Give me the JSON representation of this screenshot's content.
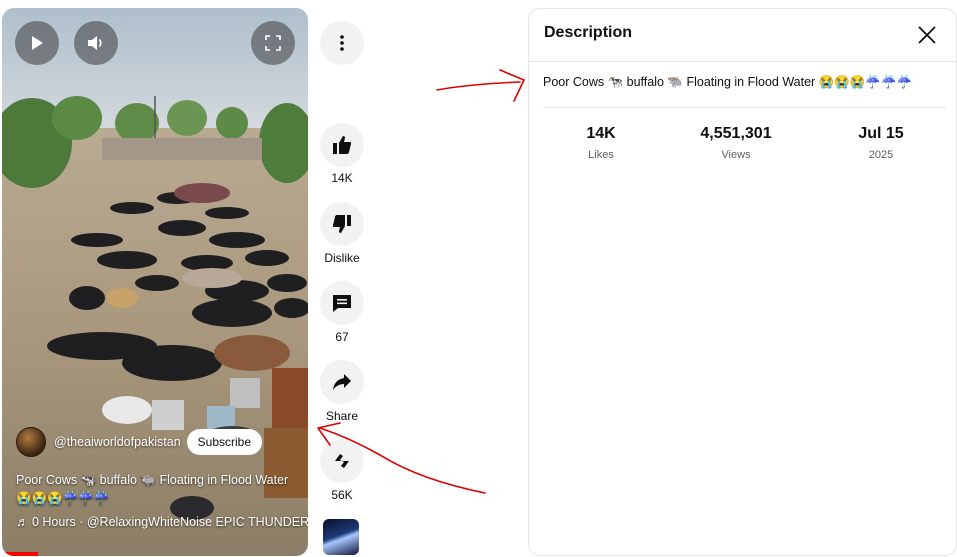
{
  "player": {
    "play_icon": "play-icon",
    "volume_icon": "volume-icon",
    "fullscreen_icon": "fullscreen-icon",
    "channel_handle": "@theaiworldofpakistan",
    "subscribe_label": "Subscribe",
    "title": "Poor Cows 🐄 buffalo 🐃 Floating in Flood Water 😭😭😭☔☔☔",
    "music_line": "♬ 0 Hours · @RelaxingWhiteNoise   EPIC THUNDER"
  },
  "actions": {
    "more_icon": "more-vertical-icon",
    "like_count": "14K",
    "dislike_label": "Dislike",
    "comment_count": "67",
    "share_label": "Share",
    "remix_count": "56K"
  },
  "description": {
    "heading": "Description",
    "close_icon": "close-icon",
    "text": "Poor Cows 🐄 buffalo 🐃 Floating in Flood Water 😭😭😭☔☔☔",
    "stats": [
      {
        "value": "14K",
        "label": "Likes"
      },
      {
        "value": "4,551,301",
        "label": "Views"
      },
      {
        "value": "Jul 15",
        "label": "2025"
      }
    ]
  },
  "colors": {
    "annotation_arrow": "#e00000",
    "progress": "#ff0000"
  }
}
